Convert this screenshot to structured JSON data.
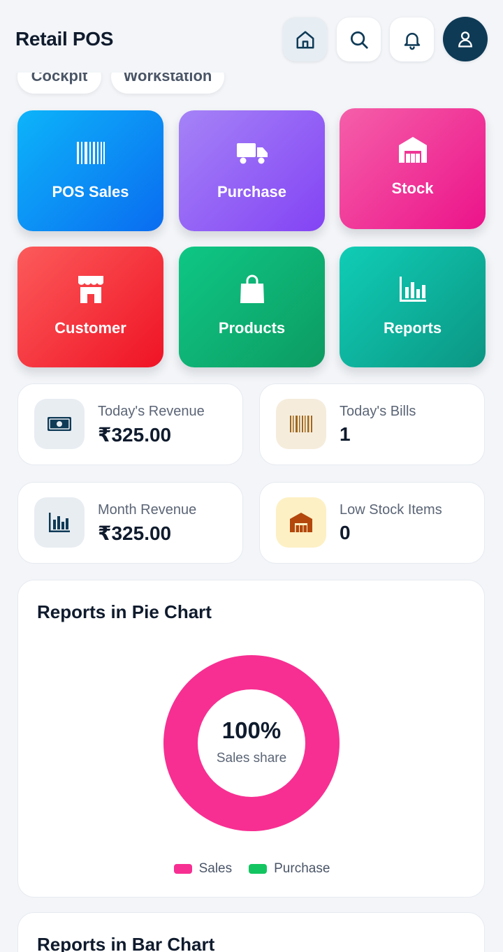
{
  "header": {
    "title": "Retail POS",
    "icons": [
      "home-icon",
      "search-icon",
      "bell-icon",
      "user-icon"
    ]
  },
  "chips": [
    "Cockpit",
    "Workstation"
  ],
  "tiles": [
    {
      "label": "POS Sales",
      "icon": "barcode-icon"
    },
    {
      "label": "Purchase",
      "icon": "truck-icon"
    },
    {
      "label": "Stock",
      "icon": "warehouse-icon"
    },
    {
      "label": "Customer",
      "icon": "storefront-icon"
    },
    {
      "label": "Products",
      "icon": "shopping-bag-icon"
    },
    {
      "label": "Reports",
      "icon": "bar-chart-icon"
    }
  ],
  "stats": [
    {
      "label": "Today's Revenue",
      "value": "₹325.00",
      "icon": "money-icon"
    },
    {
      "label": "Today's Bills",
      "value": "1",
      "icon": "barcode-icon"
    },
    {
      "label": "Month Revenue",
      "value": "₹325.00",
      "icon": "bar-chart-icon"
    },
    {
      "label": "Low Stock Items",
      "value": "0",
      "icon": "warehouse-icon"
    }
  ],
  "pie_card": {
    "title": "Reports in Pie Chart",
    "center_value": "100%",
    "center_label": "Sales share"
  },
  "bar_card": {
    "title": "Reports in Bar Chart"
  },
  "chart_data": {
    "type": "pie",
    "title": "Reports in Pie Chart",
    "series": [
      {
        "name": "Sales",
        "value": 100,
        "color": "#f72f92"
      },
      {
        "name": "Purchase",
        "value": 0,
        "color": "#13c560"
      }
    ],
    "legend_position": "bottom"
  },
  "colors": {
    "primary_dark": "#0e3a56",
    "pos_sales": "#0a8cf5",
    "purchase": "#9160f6",
    "stock": "#f03596",
    "customer": "#f5343d",
    "products": "#0db276",
    "reports": "#0eb29d"
  }
}
